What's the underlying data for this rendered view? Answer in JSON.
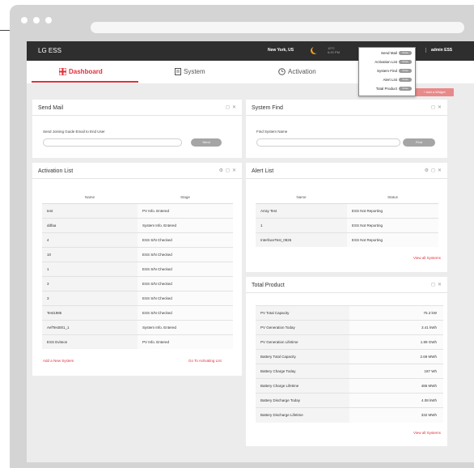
{
  "app": {
    "brand": "LG ESS",
    "location": "New York, US",
    "weather_lines": [
      "10°C",
      "6:20 PM"
    ],
    "admin": "admin ESS"
  },
  "tabs": [
    {
      "label": "Dashboard",
      "icon": "grid-icon"
    },
    {
      "label": "System",
      "icon": "document-icon"
    },
    {
      "label": "Activation",
      "icon": "clock-icon"
    }
  ],
  "add_widget": "+ Add a Widget",
  "widget_menu": [
    {
      "label": "Send Mail",
      "toggle": "Close"
    },
    {
      "label": "Activation List",
      "toggle": "Close"
    },
    {
      "label": "System Find",
      "toggle": "Close"
    },
    {
      "label": "Alert List",
      "toggle": "Close"
    },
    {
      "label": "Total Product",
      "toggle": "Close"
    }
  ],
  "send_mail": {
    "title": "Send Mail",
    "label": "Send Joining Guide Email to End User",
    "input_value": "",
    "button": "Send"
  },
  "system_find": {
    "title": "System Find",
    "label": "Find System Name",
    "input_value": "",
    "button": "Find"
  },
  "activation_list": {
    "title": "Activation List",
    "headers": [
      "Name",
      "Stage"
    ],
    "rows": [
      [
        "test",
        "PV Info. Entered"
      ],
      [
        "ddfaa",
        "System Info. Entered"
      ],
      [
        "4",
        "ESS S/N Checked"
      ],
      [
        "10",
        "ESS S/N Checked"
      ],
      [
        "1",
        "ESS S/N Checked"
      ],
      [
        "3",
        "ESS S/N Checked"
      ],
      [
        "3",
        "ESS S/N Checked"
      ],
      [
        "Test1985",
        "ESS S/N Checked"
      ],
      [
        "AefTest001_1",
        "System Info. Entered"
      ],
      [
        "ESS Eviteon",
        "PV Info. Entered"
      ]
    ],
    "add_link": "Add a New System",
    "go_link": "Go To Activating List"
  },
  "alert_list": {
    "title": "Alert List",
    "headers": [
      "Name",
      "Status"
    ],
    "rows": [
      [
        "Array Test",
        "ESS Not Reporting"
      ],
      [
        "1",
        "ESS Not Reporting"
      ],
      [
        "InterfaceTest_0826",
        "ESS Not Reporting"
      ]
    ],
    "view_all": "View all Systems"
  },
  "total_product": {
    "title": "Total Product",
    "rows": [
      [
        "PV Total Capacity",
        "75.3 kW"
      ],
      [
        "PV Generation Today",
        "3.41 kWh"
      ],
      [
        "PV Generation Lifetime",
        "1.89 GWh"
      ],
      [
        "Battery Total Capacity",
        "2.69 MWh"
      ],
      [
        "Battery Charge Today",
        "187 Wh"
      ],
      [
        "Battery Charge Lifetime",
        "486 MWh"
      ],
      [
        "Battery Discharge Today",
        "4.08 kWh"
      ],
      [
        "Battery Discharge Lifetime",
        "332 MWh"
      ]
    ],
    "view_all": "View all Systems"
  }
}
